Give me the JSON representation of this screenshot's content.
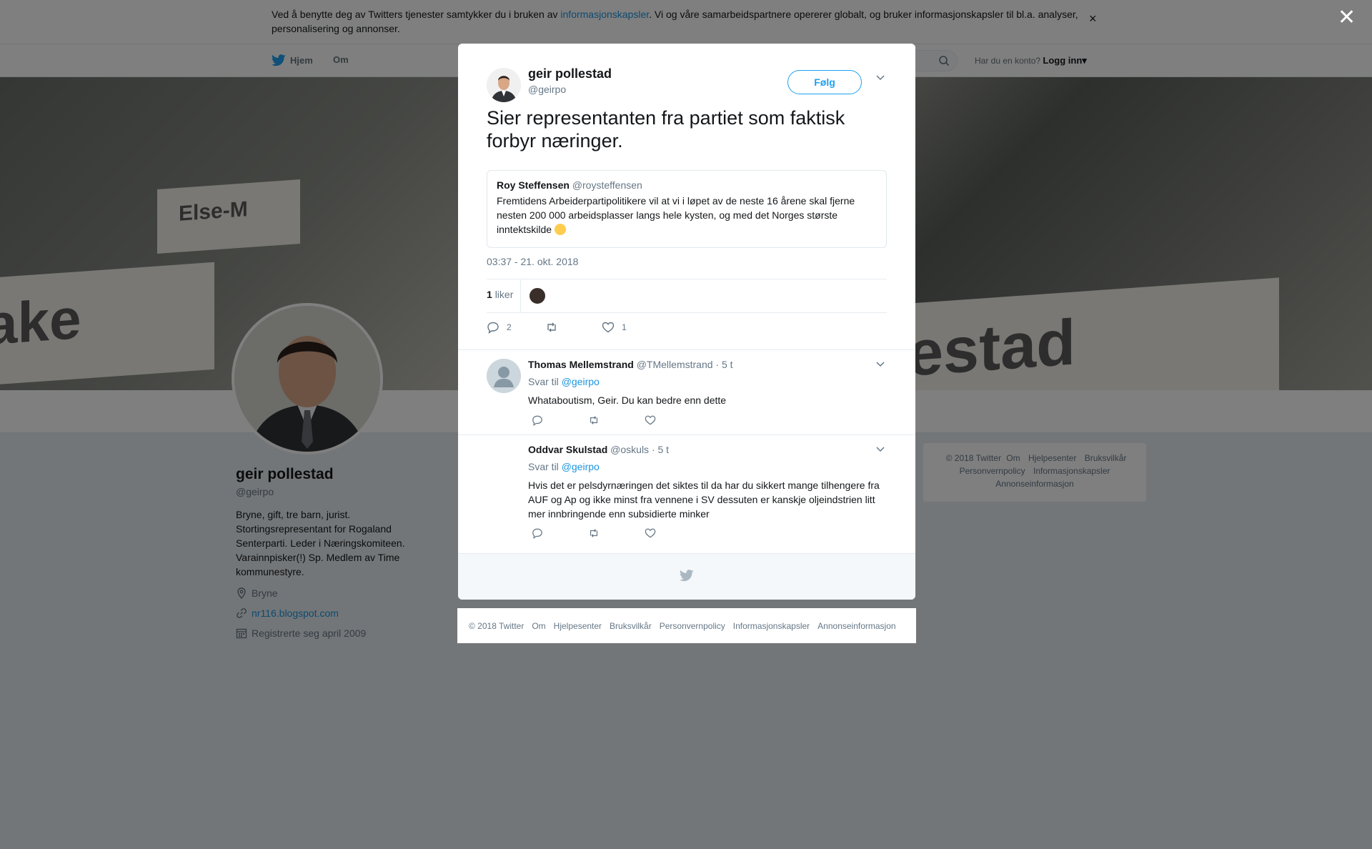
{
  "cookie": {
    "text_before": "Ved å benytte deg av Twitters tjenester samtykker du i bruken av ",
    "link": "informasjonskapsler",
    "text_after": ". Vi og våre samarbeidspartnere opererer globalt, og bruker informasjonskapsler til bl.a. analyser, personalisering og annonser.",
    "close": "×"
  },
  "nav": {
    "home": "Hjem",
    "about": "Om",
    "account_question": "Har du en konto?",
    "login": "Logg inn",
    "login_caret": "▾"
  },
  "banner": {
    "plate_left": "ake",
    "plate_mid": "Else-M",
    "plate_right": "estad"
  },
  "profile": {
    "name": "geir pollestad",
    "handle": "@geirpo",
    "bio": "Bryne, gift, tre barn, jurist. Stortingsrepresentant for Rogaland Senterparti. Leder i Næringskomiteen. Varainnpisker(!) Sp. Medlem av Time kommunestyre.",
    "location": "Bryne",
    "website": "nr116.blogspot.com",
    "joined": "Registrerte seg april 2009"
  },
  "right_footer": {
    "items": [
      "© 2018 Twitter",
      "Om",
      "Hjelpesenter",
      "Bruksvilkår",
      "Personvernpolicy",
      "Informasjonskapsler",
      "Annonseinformasjon"
    ]
  },
  "overlay": {
    "close": "✕"
  },
  "tweet": {
    "name": "geir pollestad",
    "handle": "@geirpo",
    "follow": "Følg",
    "text": "Sier representanten fra partiet som faktisk forbyr næringer.",
    "quote": {
      "name": "Roy Steffensen",
      "handle": "@roysteffensen",
      "text": "Fremtidens Arbeiderpartipolitikere vil at vi i løpet av de neste 16 årene skal fjerne nesten 200 000 arbeidsplasser langs hele kysten, og med det Norges største inntektskilde"
    },
    "time": "03:37 - 21. okt. 2018",
    "likes_count": "1",
    "likes_label": "liker",
    "reply_count": "2",
    "like_count": "1"
  },
  "replies": [
    {
      "name": "Thomas Mellemstrand",
      "handle": "@TMellemstrand",
      "time": "· 5 t",
      "svar_til": "Svar til",
      "mention": "@geirpo",
      "text": "Whataboutism, Geir. Du kan bedre enn dette"
    },
    {
      "name": "Oddvar Skulstad",
      "handle": "@oskuls",
      "time": "· 5 t",
      "svar_til": "Svar til",
      "mention": "@geirpo",
      "text": "Hvis det er pelsdyrnæringen det siktes til da har du sikkert mange tilhengere fra AUF og Ap og ikke minst fra vennene i SV dessuten er kanskje oljeindstrien litt mer innbringende enn subsidierte minker"
    }
  ],
  "bottom_footer": {
    "items": [
      "© 2018 Twitter",
      "Om",
      "Hjelpesenter",
      "Bruksvilkår",
      "Personvernpolicy",
      "Informasjonskapsler",
      "Annonseinformasjon"
    ]
  },
  "colors": {
    "brand": "#1da1f2",
    "link": "#1b95e0",
    "muted": "#657786",
    "text": "#14171a"
  }
}
